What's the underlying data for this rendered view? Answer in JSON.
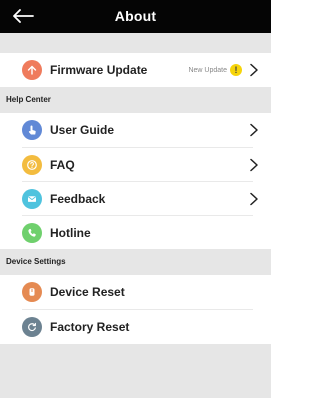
{
  "header": {
    "title": "About"
  },
  "firmware": {
    "label": "Firmware Update",
    "status": "New Update",
    "badge": "!"
  },
  "help_center": {
    "title": "Help Center",
    "items": [
      {
        "label": "User Guide"
      },
      {
        "label": "FAQ"
      },
      {
        "label": "Feedback"
      },
      {
        "label": "Hotline"
      }
    ]
  },
  "device_settings": {
    "title": "Device Settings",
    "items": [
      {
        "label": "Device Reset"
      },
      {
        "label": "Factory Reset"
      }
    ]
  },
  "icons": {
    "firmware": "upload-arrow-icon",
    "user_guide": "hand-pointer-icon",
    "faq": "question-icon",
    "feedback": "envelope-icon",
    "hotline": "phone-icon",
    "device_reset": "power-icon",
    "factory_reset": "reset-icon"
  },
  "colors": {
    "header_bg": "#050505",
    "firmware_icon": "#ef7b5c",
    "user_guide_icon": "#6189d6",
    "faq_icon": "#f3bc3f",
    "feedback_icon": "#4fc3de",
    "hotline_icon": "#6fd06d",
    "device_reset_icon": "#e58a52",
    "factory_reset_icon": "#6c8291",
    "badge": "#f6d40a",
    "section_bg": "#e6e6e6"
  }
}
